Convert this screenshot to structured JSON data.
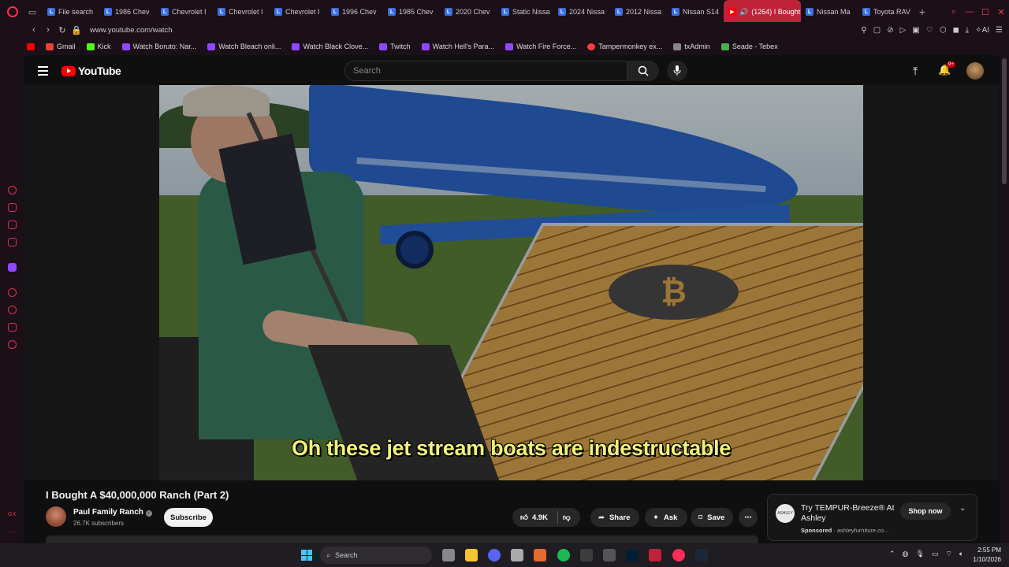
{
  "browser": {
    "tabs": [
      {
        "label": "File search"
      },
      {
        "label": "1986 Chev"
      },
      {
        "label": "Chevrolet I"
      },
      {
        "label": "Chevrolet I"
      },
      {
        "label": "Chevrolet I"
      },
      {
        "label": "1996 Chev"
      },
      {
        "label": "1985 Chev"
      },
      {
        "label": "2020 Chev"
      },
      {
        "label": "Static Nissa"
      },
      {
        "label": "2024 Nissa"
      },
      {
        "label": "2012 Nissa"
      },
      {
        "label": "Nissan S14"
      },
      {
        "label": "(1264) I Bought A"
      },
      {
        "label": "Nissan Ma"
      },
      {
        "label": "Toyota RAV"
      }
    ],
    "url": "www.youtube.com/watch",
    "bookmarks": [
      {
        "label": "Gmail",
        "color": "#ea4335"
      },
      {
        "label": "Kick",
        "color": "#53fc18"
      },
      {
        "label": "Watch Boruto: Nar...",
        "color": "#9146ff"
      },
      {
        "label": "Watch Bleach onli...",
        "color": "#9146ff"
      },
      {
        "label": "Watch Black Clove...",
        "color": "#9146ff"
      },
      {
        "label": "Twitch",
        "color": "#9146ff"
      },
      {
        "label": "Watch Hell's Para...",
        "color": "#9146ff"
      },
      {
        "label": "Watch Fire Force...",
        "color": "#9146ff"
      },
      {
        "label": "Tampermonkey ex...",
        "color": "#ff3b3b"
      },
      {
        "label": "txAdmin",
        "color": "#888888"
      },
      {
        "label": "Seade - Tebex",
        "color": "#4caf50"
      }
    ],
    "ai_label": "AI"
  },
  "youtube": {
    "logo_text": "YouTube",
    "search_placeholder": "Search",
    "notification_badge": "9+",
    "video": {
      "caption": "Oh these jet stream boats are indestructable",
      "title": "I Bought A $40,000,000 Ranch (Part 2)"
    },
    "channel": {
      "name": "Paul Family Ranch",
      "subscribers": "26.7K subscribers",
      "subscribe_label": "Subscribe"
    },
    "actions": {
      "likes": "4.9K",
      "share": "Share",
      "ask": "Ask",
      "save": "Save"
    },
    "ad": {
      "title": "Try TEMPUR-Breeze® At Ashley",
      "sponsored": "Sponsored",
      "domain": "ashleyfurniture.co...",
      "cta": "Shop now",
      "logo_text": "ASHLEY"
    }
  },
  "taskbar": {
    "search_label": "Search",
    "time": "2:55 PM",
    "date": "1/10/2026"
  },
  "colors": {
    "opera_accent": "#ff2d55",
    "active_tab": "#c0223a",
    "youtube_red": "#ff0000",
    "caption_yellow": "#f2f27c"
  }
}
